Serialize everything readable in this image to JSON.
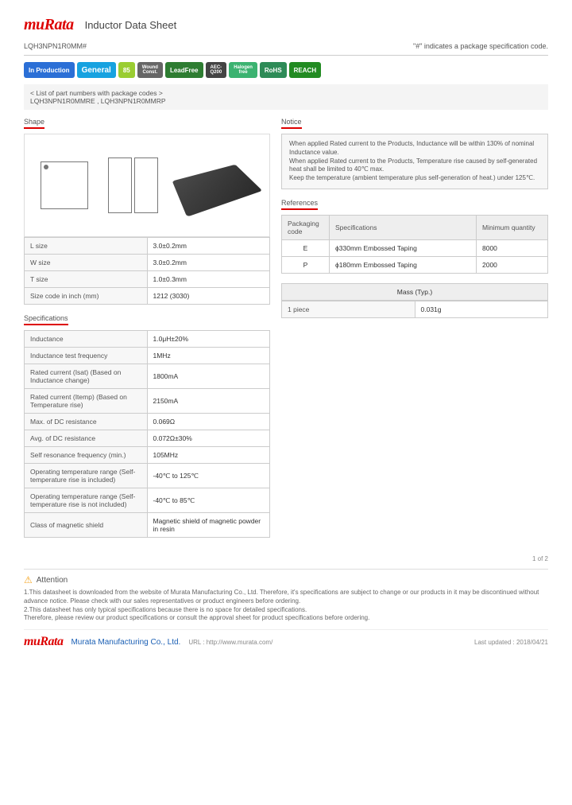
{
  "header": {
    "logo": "muRata",
    "title": "Inductor Data Sheet"
  },
  "partrow": {
    "pn": "LQH3NPN1R0MM#",
    "note": "\"#\" indicates a package specification code."
  },
  "badges": {
    "prod": "In Production",
    "gen": "General",
    "t85": "85",
    "wound": "Wound\nConst.",
    "pb": "LeadFree",
    "aec": "AEC-\nQ200",
    "halo": "Halogen\nfree",
    "rohs": "RoHS",
    "reach": "REACH"
  },
  "listnote": {
    "head": "< List of part numbers with package codes >",
    "body": "LQH3NPN1R0MMRE , LQH3NPN1R0MMRP"
  },
  "sections": {
    "shape": "Shape",
    "specs": "Specifications",
    "notice": "Notice",
    "refs": "References"
  },
  "dims": {
    "rows": [
      {
        "k": "L size",
        "v": "3.0±0.2mm"
      },
      {
        "k": "W size",
        "v": "3.0±0.2mm"
      },
      {
        "k": "T size",
        "v": "1.0±0.3mm"
      },
      {
        "k": "Size code in inch (mm)",
        "v": "1212 (3030)"
      }
    ]
  },
  "specs": {
    "rows": [
      {
        "k": "Inductance",
        "v": "1.0μH±20%"
      },
      {
        "k": "Inductance test frequency",
        "v": "1MHz"
      },
      {
        "k": "Rated current (Isat) (Based on Inductance change)",
        "v": "1800mA"
      },
      {
        "k": "Rated current (Itemp) (Based on Temperature rise)",
        "v": "2150mA"
      },
      {
        "k": "Max. of DC resistance",
        "v": "0.069Ω"
      },
      {
        "k": "Avg. of DC resistance",
        "v": "0.072Ω±30%"
      },
      {
        "k": "Self resonance frequency (min.)",
        "v": "105MHz"
      },
      {
        "k": "Operating temperature range (Self-temperature rise is included)",
        "v": "-40℃ to 125℃"
      },
      {
        "k": "Operating temperature range (Self-temperature rise is not included)",
        "v": "-40℃ to 85℃"
      },
      {
        "k": "Class of magnetic shield",
        "v": "Magnetic shield of magnetic powder in resin"
      }
    ]
  },
  "notice": {
    "lines": [
      "When applied Rated current to the Products, Inductance will be within 130% of nominal Inductance value.",
      "When applied Rated current to the Products, Temperature rise caused by self-generated heat shall be limited to 40℃ max.",
      "Keep the temperature (ambient temperature plus self-generation of heat.) under 125℃."
    ]
  },
  "refs": {
    "headers": [
      "Packaging code",
      "Specifications",
      "Minimum quantity"
    ],
    "rows": [
      {
        "c": "E",
        "s": "ϕ330mm Embossed Taping",
        "q": "8000"
      },
      {
        "c": "P",
        "s": "ϕ180mm Embossed Taping",
        "q": "2000"
      }
    ]
  },
  "mass": {
    "title": "Mass (Typ.)",
    "k": "1 piece",
    "v": "0.031g"
  },
  "pagenum": "1 of 2",
  "attention": {
    "title": "Attention",
    "l1": "1.This datasheet is downloaded from the website of Murata Manufacturing Co., Ltd. Therefore, it's specifications are subject to change or our products in it may be discontinued without advance notice. Please check with our sales representatives or product engineers before ordering.",
    "l2": "2.This datasheet has only typical specifications because there is no space for detailed specifications.",
    "l3": "Therefore, please review our product specifications or consult the approval sheet for product specifications before ordering."
  },
  "footer": {
    "co": "Murata Manufacturing Co., Ltd.",
    "url_label": "URL : http://www.murata.com/",
    "upd": "Last updated : 2018/04/21"
  }
}
